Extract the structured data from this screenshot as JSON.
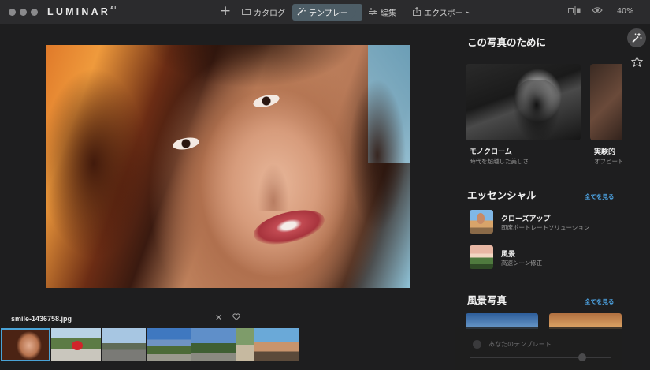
{
  "app": {
    "logo_text": "LUMINAR",
    "logo_suffix": "AI"
  },
  "toolbar": {
    "add_label": "+",
    "nav": [
      {
        "label": "カタログ",
        "icon": "folder-icon",
        "active": false
      },
      {
        "label": "テンプレート",
        "icon": "magic-wand-icon",
        "active": true
      },
      {
        "label": "編集",
        "icon": "sliders-icon",
        "active": false
      },
      {
        "label": "エクスポート",
        "icon": "share-icon",
        "active": false
      }
    ],
    "zoom": "40%"
  },
  "image": {
    "filename": "smile-1436758.jpg"
  },
  "panel": {
    "for_photo": {
      "title": "この写真のために",
      "cards": [
        {
          "title": "モノクローム",
          "subtitle": "時代を超越した美しさ"
        },
        {
          "title": "実験的",
          "subtitle": "オフビート"
        }
      ]
    },
    "essentials": {
      "title": "エッセンシャル",
      "see_all": "全てを見る",
      "items": [
        {
          "title": "クローズアップ",
          "subtitle": "即席ポートレートソリューション"
        },
        {
          "title": "風景",
          "subtitle": "高速シーン修正"
        }
      ]
    },
    "landscape": {
      "title": "風景写真",
      "see_all": "全てを見る"
    },
    "yours": {
      "label": "あなたのテンプレート"
    }
  },
  "icons": {
    "rail": [
      "magic-wand-icon",
      "star-icon"
    ],
    "compare": "compare-view-icon",
    "eye": "eye-icon",
    "close": "close-icon",
    "favorite": "heart-icon"
  },
  "colors": {
    "accent": "#4ea6e6",
    "active_tab": "#4d5d66",
    "background": "#1e1e1f",
    "topbar": "#2b2b2d"
  }
}
